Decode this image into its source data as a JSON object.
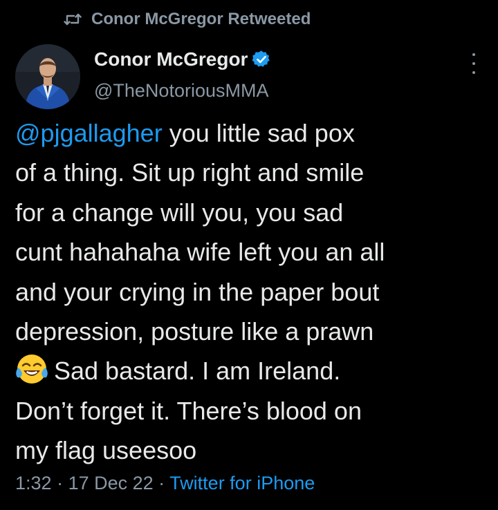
{
  "retweet_banner": {
    "icon": "retweet-icon",
    "text": "Conor McGregor Retweeted"
  },
  "author": {
    "avatar_icon": "avatar",
    "name": "Conor McGregor",
    "verified_icon": "verified-badge-icon",
    "handle": "@TheNotoriousMMA"
  },
  "tweet": {
    "mention": "@pjgallagher",
    "line1_rest": " you little sad pox",
    "line2": "of a thing. Sit up right and smile",
    "line3": "for a change will you, you sad",
    "line4": "cunt hahahaha wife left you an all",
    "line5": "and your crying in the paper bout",
    "line6": "depression, posture like a prawn",
    "emoji_icon": "face-with-tears-of-joy-icon",
    "line7_rest": "Sad bastard. I am Ireland.",
    "line8": "Don’t forget it. There’s blood on",
    "line9": "my flag useesoo"
  },
  "meta": {
    "time": "1:32",
    "separator1": " · ",
    "date": "17 Dec 22",
    "separator2": " · ",
    "source": "Twitter for iPhone"
  },
  "colors": {
    "background": "#000000",
    "text": "#e7e9ea",
    "secondary": "#8b98a5",
    "accent": "#1d9bf0"
  }
}
